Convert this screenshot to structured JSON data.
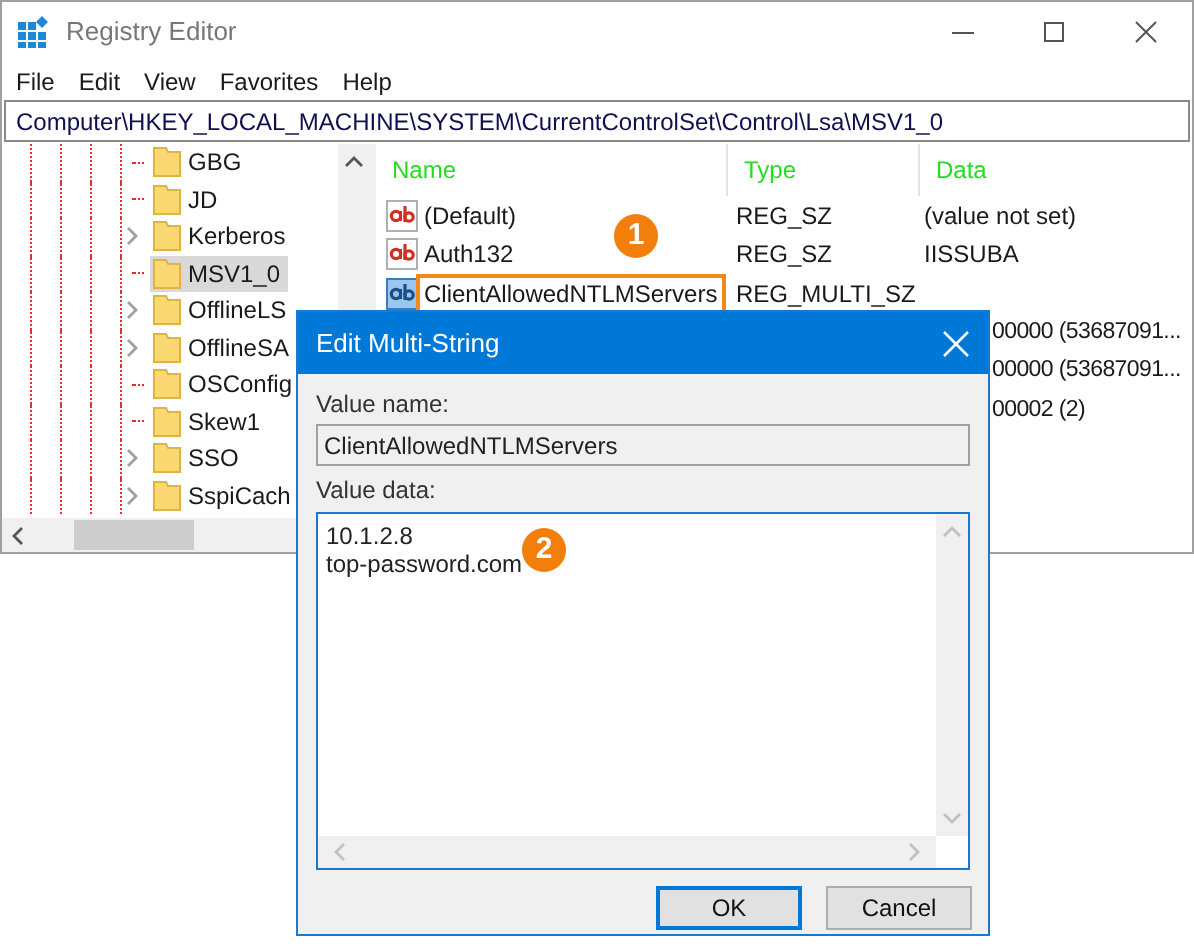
{
  "window": {
    "title": "Registry Editor"
  },
  "menu": [
    "File",
    "Edit",
    "View",
    "Favorites",
    "Help"
  ],
  "address": "Computer\\HKEY_LOCAL_MACHINE\\SYSTEM\\CurrentControlSet\\Control\\Lsa\\MSV1_0",
  "tree": {
    "items": [
      {
        "label": "GBG",
        "expandable": false,
        "selected": false
      },
      {
        "label": "JD",
        "expandable": false,
        "selected": false
      },
      {
        "label": "Kerberos",
        "expandable": true,
        "selected": false
      },
      {
        "label": "MSV1_0",
        "expandable": false,
        "selected": true
      },
      {
        "label": "OfflineLS",
        "expandable": true,
        "selected": false
      },
      {
        "label": "OfflineSA",
        "expandable": true,
        "selected": false
      },
      {
        "label": "OSConfig",
        "expandable": false,
        "selected": false
      },
      {
        "label": "Skew1",
        "expandable": false,
        "selected": false
      },
      {
        "label": "SSO",
        "expandable": true,
        "selected": false
      },
      {
        "label": "SspiCach",
        "expandable": true,
        "selected": false
      }
    ]
  },
  "values": {
    "columns": [
      "Name",
      "Type",
      "Data"
    ],
    "rows": [
      {
        "kind": "string",
        "name": "(Default)",
        "type": "REG_SZ",
        "data": "(value not set)",
        "highlighted": false
      },
      {
        "kind": "string",
        "name": "Auth132",
        "type": "REG_SZ",
        "data": "IISSUBA",
        "highlighted": false
      },
      {
        "kind": "multi",
        "name": "ClientAllowedNTLMServers",
        "type": "REG_MULTI_SZ",
        "highlighted": true
      },
      {
        "kind": "cut",
        "data": "00000 (53687091..."
      },
      {
        "kind": "cut",
        "data": "00000 (53687091..."
      },
      {
        "kind": "cut",
        "data": "00002 (2)"
      }
    ]
  },
  "callouts": [
    "1",
    "2"
  ],
  "dialog": {
    "title": "Edit Multi-String",
    "name_label": "Value name:",
    "name_value": "ClientAllowedNTLMServers",
    "data_label": "Value data:",
    "data_lines": [
      "10.1.2.8",
      "top-password.com"
    ],
    "buttons": [
      {
        "label": "OK",
        "default": true
      },
      {
        "label": "Cancel",
        "default": false
      }
    ]
  }
}
